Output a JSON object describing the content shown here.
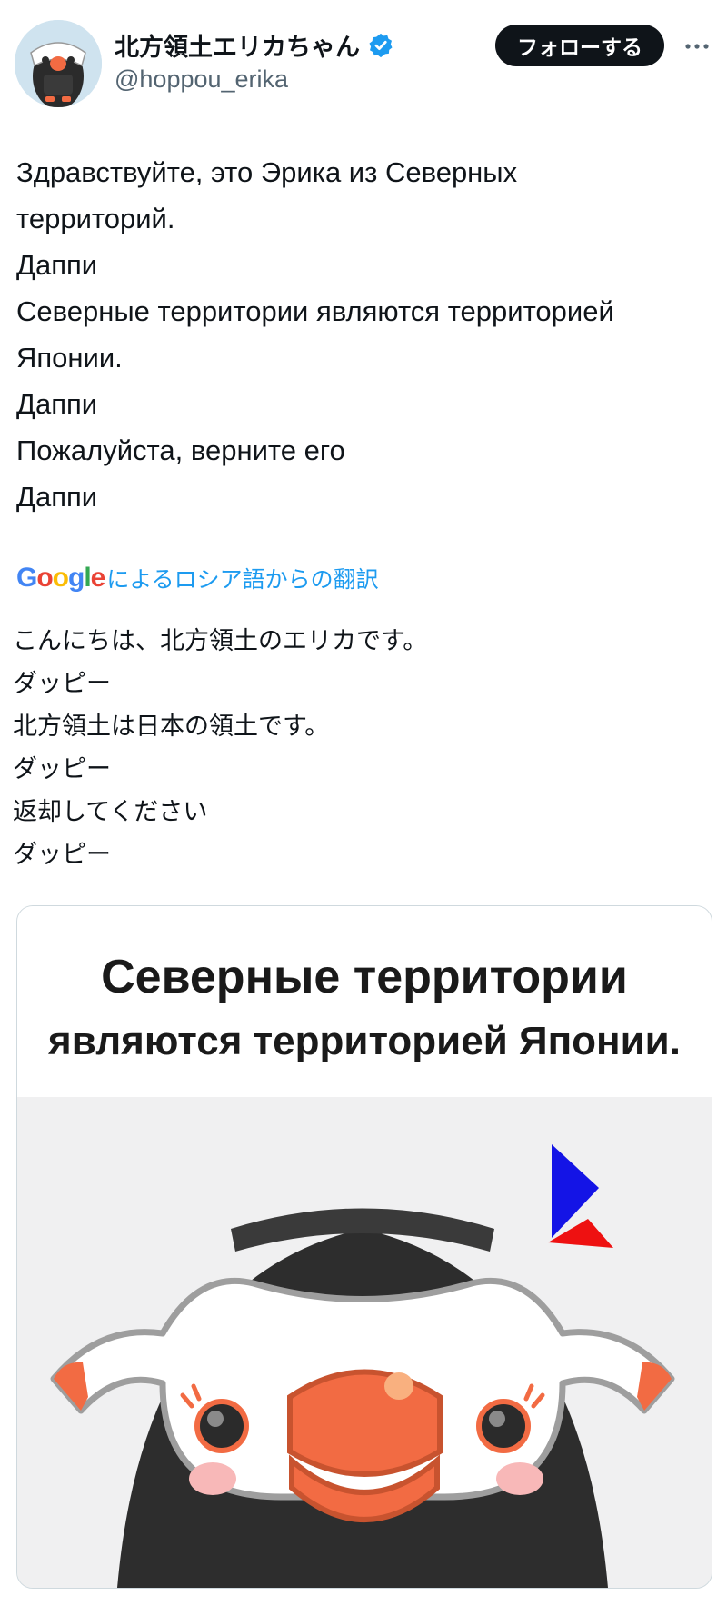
{
  "profile": {
    "display_name": "北方領土エリカちゃん",
    "handle": "@hoppou_erika",
    "verified": true,
    "verified_color": "#1d9bf0"
  },
  "follow_button": {
    "label": "フォローする"
  },
  "more_icon": "more-horizontal-icon",
  "tweet": {
    "lines": [
      "Здравствуйте, это Эрика из Северных",
      "территорий.",
      "Даппи",
      "Северные территории являются территорией",
      "Японии.",
      "Даппи",
      "Пожалуйста, верните его",
      "Даппи"
    ]
  },
  "translation": {
    "provider": "Google",
    "label": "によるロシア語からの翻訳",
    "lines": [
      "こんにちは、北方領土のエリカです。",
      "ダッピー",
      "北方領土は日本の領土です。",
      "ダッピー",
      "返却してください",
      "ダッピー"
    ]
  },
  "media": {
    "headline_line1": "Северные территории",
    "headline_line2": "являются территорией Японии."
  }
}
